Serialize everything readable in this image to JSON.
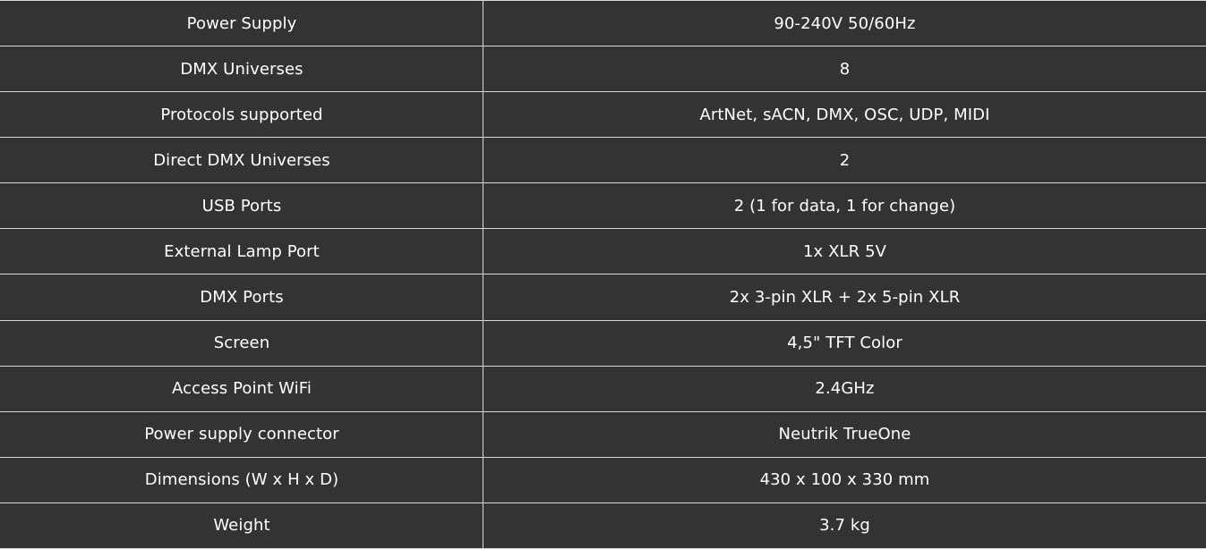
{
  "colors": {
    "background": "#333333",
    "text": "#ffffff",
    "border": "#d9d9d9"
  },
  "specs": [
    {
      "label": "Power Supply",
      "value": "90-240V 50/60Hz"
    },
    {
      "label": "DMX Universes",
      "value": "8"
    },
    {
      "label": "Protocols supported",
      "value": "ArtNet, sACN, DMX, OSC, UDP, MIDI"
    },
    {
      "label": "Direct DMX Universes",
      "value": "2"
    },
    {
      "label": "USB Ports",
      "value": "2 (1 for data, 1 for change)"
    },
    {
      "label": "External Lamp Port",
      "value": "1x XLR 5V"
    },
    {
      "label": "DMX Ports",
      "value": "2x 3-pin XLR + 2x 5-pin XLR"
    },
    {
      "label": "Screen",
      "value": "4,5\" TFT Color"
    },
    {
      "label": "Access Point WiFi",
      "value": "2.4GHz"
    },
    {
      "label": "Power supply connector",
      "value": "Neutrik TrueOne"
    },
    {
      "label": "Dimensions (W x H x D)",
      "value": "430 x 100 x 330 mm"
    },
    {
      "label": "Weight",
      "value": "3.7 kg"
    }
  ]
}
